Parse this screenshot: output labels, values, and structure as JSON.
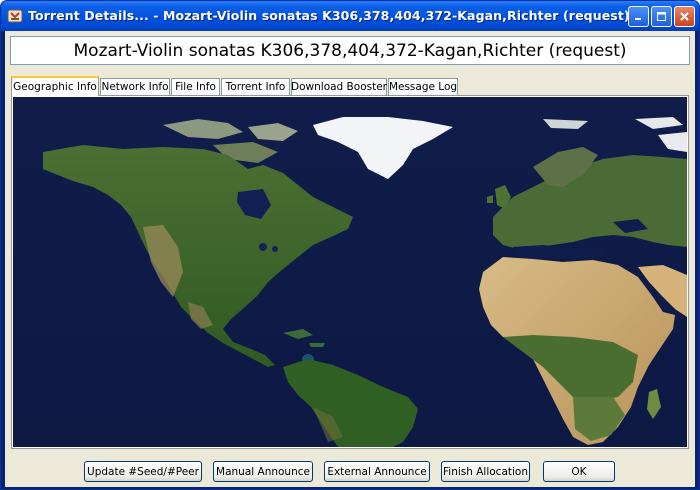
{
  "window": {
    "title": "Torrent Details... - Mozart-Violin sonatas  K306,378,404,372-Kagan,Richter (request)",
    "icon": "torrent-app-icon"
  },
  "header": {
    "torrent_name": "Mozart-Violin sonatas  K306,378,404,372-Kagan,Richter (request)"
  },
  "tabs": [
    {
      "label": "Geographic Info",
      "active": true
    },
    {
      "label": "Network Info",
      "active": false
    },
    {
      "label": "File Info",
      "active": false
    },
    {
      "label": "Torrent Info",
      "active": false
    },
    {
      "label": "Download Booster",
      "active": false
    },
    {
      "label": "Message Log",
      "active": false
    }
  ],
  "buttons": {
    "update_seed_peer": "Update #Seed/#Peer",
    "manual_announce": "Manual Announce",
    "external_announce": "External Announce",
    "finish_allocation": "Finish Allocation",
    "ok": "OK"
  },
  "colors": {
    "title_bar": "#0554e0",
    "ocean": "#0f1d4d",
    "land": "#3d6a2a",
    "desert": "#c9a86a",
    "ice": "#f2f4f5",
    "active_tab_accent": "#ffc83c"
  }
}
